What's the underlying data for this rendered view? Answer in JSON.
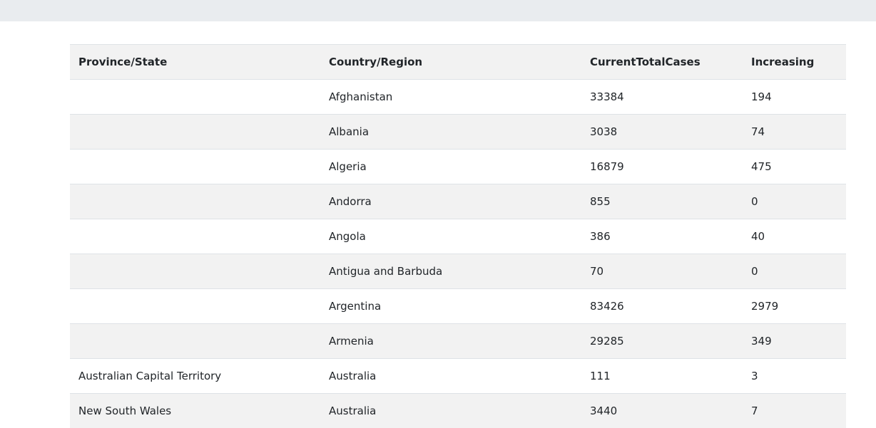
{
  "table": {
    "headers": [
      "Province/State",
      "Country/Region",
      "CurrentTotalCases",
      "Increasing"
    ],
    "rows": [
      {
        "province": "",
        "country": "Afghanistan",
        "cases": "33384",
        "increasing": "194"
      },
      {
        "province": "",
        "country": "Albania",
        "cases": "3038",
        "increasing": "74"
      },
      {
        "province": "",
        "country": "Algeria",
        "cases": "16879",
        "increasing": "475"
      },
      {
        "province": "",
        "country": "Andorra",
        "cases": "855",
        "increasing": "0"
      },
      {
        "province": "",
        "country": "Angola",
        "cases": "386",
        "increasing": "40"
      },
      {
        "province": "",
        "country": "Antigua and Barbuda",
        "cases": "70",
        "increasing": "0"
      },
      {
        "province": "",
        "country": "Argentina",
        "cases": "83426",
        "increasing": "2979"
      },
      {
        "province": "",
        "country": "Armenia",
        "cases": "29285",
        "increasing": "349"
      },
      {
        "province": "Australian Capital Territory",
        "country": "Australia",
        "cases": "111",
        "increasing": "3"
      },
      {
        "province": "New South Wales",
        "country": "Australia",
        "cases": "3440",
        "increasing": "7"
      }
    ]
  }
}
